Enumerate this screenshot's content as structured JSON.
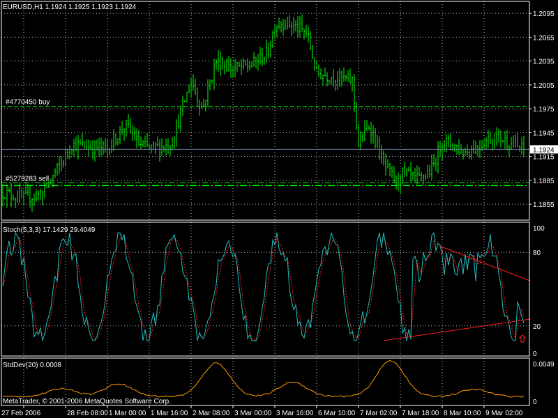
{
  "window": {
    "symbol_header": "EURUSD,H1  1.1924 1.1925 1.1923 1.1924",
    "copyright": "MetaTrader, © 2001-2006 MetaQuotes Software Corp."
  },
  "colors": {
    "background": "#000000",
    "grid": "#ffffff",
    "price_bars": "#00ff00",
    "current_price_line": "#6a7a9a",
    "order_lines": "#00ff00",
    "stoch_main": "#20c0c0",
    "stoch_signal": "#ff2020",
    "trendline": "#ff2020",
    "stddev": "#ff9c00",
    "arrow": "#ff2020"
  },
  "price_panel": {
    "current_price_label": "1.1924",
    "orders": [
      {
        "label": "#4770450 buy",
        "price": 1.1978,
        "style": "dashed"
      },
      {
        "label": "#5279283 sell",
        "price": 1.1882,
        "style": "dashdot"
      }
    ],
    "y_axis": [
      "1.2095",
      "1.2065",
      "1.2035",
      "1.2005",
      "1.1975",
      "1.1945",
      "1.1915",
      "1.1885",
      "1.1855"
    ]
  },
  "stoch_panel": {
    "label": "Stoch(5,3,3) 17.1429 29.4049",
    "y_axis": [
      "100",
      "80",
      "20",
      "0"
    ]
  },
  "stddev_panel": {
    "label": "StdDev(20) 0.0008",
    "y_axis": [
      "0.0049",
      "0"
    ]
  },
  "time_axis": [
    "27 Feb 2006",
    "28 Feb 08:00",
    "1 Mar 00:00",
    "1 Mar 16:00",
    "2 Mar 08:00",
    "3 Mar 00:00",
    "3 Mar 16:00",
    "6 Mar 10:00",
    "7 Mar 02:00",
    "7 Mar 18:00",
    "8 Mar 10:00",
    "9 Mar 02:00"
  ],
  "chart_data": {
    "type": "ohlc",
    "symbol": "EURUSD",
    "timeframe": "H1",
    "price_anchors": [
      {
        "time": "27 Feb 2006",
        "price": 1.1862
      },
      {
        "time": "28 Feb 08:00",
        "price": 1.1915
      },
      {
        "time": "1 Mar 00:00",
        "price": 1.1925
      },
      {
        "time": "1 Mar 16:00",
        "price": 1.1925
      },
      {
        "time": "2 Mar 08:00",
        "price": 1.201
      },
      {
        "time": "3 Mar 00:00",
        "price": 1.2025
      },
      {
        "time": "3 Mar 16:00",
        "price": 1.208
      },
      {
        "time": "6 Mar 10:00",
        "price": 1.202
      },
      {
        "time": "7 Mar 02:00",
        "price": 1.193
      },
      {
        "time": "7 Mar 18:00",
        "price": 1.1895
      },
      {
        "time": "8 Mar 10:00",
        "price": 1.1935
      },
      {
        "time": "9 Mar 02:00",
        "price": 1.1935
      }
    ],
    "last_price": 1.1924,
    "price_range": [
      1.1835,
      1.211
    ],
    "stochastic": {
      "k": 17.1429,
      "d": 29.4049,
      "range": [
        0,
        100
      ]
    },
    "stddev": {
      "value": 0.0008,
      "range": [
        0,
        0.0049
      ]
    }
  }
}
